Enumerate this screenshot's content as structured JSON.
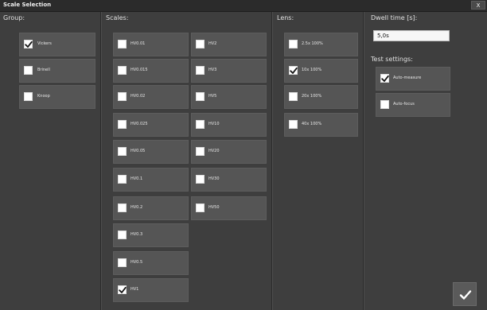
{
  "window": {
    "title": "Scale Selection",
    "close_label": "X"
  },
  "group": {
    "heading": "Group:",
    "items": [
      {
        "label": "Vickers",
        "checked": true
      },
      {
        "label": "Brinell",
        "checked": false
      },
      {
        "label": "Knoop",
        "checked": false
      }
    ]
  },
  "scales": {
    "heading": "Scales:",
    "column1": [
      {
        "label": "HV0.01",
        "checked": false
      },
      {
        "label": "HV0.015",
        "checked": false
      },
      {
        "label": "HV0.02",
        "checked": false
      },
      {
        "label": "HV0.025",
        "checked": false
      },
      {
        "label": "HV0.05",
        "checked": false
      },
      {
        "label": "HV0.1",
        "checked": false
      },
      {
        "label": "HV0.2",
        "checked": false
      },
      {
        "label": "HV0.3",
        "checked": false
      },
      {
        "label": "HV0.5",
        "checked": false
      },
      {
        "label": "HV1",
        "checked": true
      }
    ],
    "column2": [
      {
        "label": "HV2",
        "checked": false
      },
      {
        "label": "HV3",
        "checked": false
      },
      {
        "label": "HV5",
        "checked": false
      },
      {
        "label": "HV10",
        "checked": false
      },
      {
        "label": "HV20",
        "checked": false
      },
      {
        "label": "HV30",
        "checked": false
      },
      {
        "label": "HV50",
        "checked": false
      }
    ]
  },
  "lens": {
    "heading": "Lens:",
    "items": [
      {
        "label": "2.5x 100%",
        "checked": false
      },
      {
        "label": "10x 100%",
        "checked": true
      },
      {
        "label": "20x 100%",
        "checked": false
      },
      {
        "label": "40x 100%",
        "checked": false
      }
    ]
  },
  "dwell": {
    "heading": "Dwell time [s]:",
    "value": "5,0s"
  },
  "test_settings": {
    "heading": "Test settings:",
    "items": [
      {
        "label": "Auto-measure",
        "checked": true
      },
      {
        "label": "Auto-focus",
        "checked": false
      }
    ]
  },
  "icons": {
    "check": "checkmark-icon",
    "ok": "confirm-check-icon"
  }
}
